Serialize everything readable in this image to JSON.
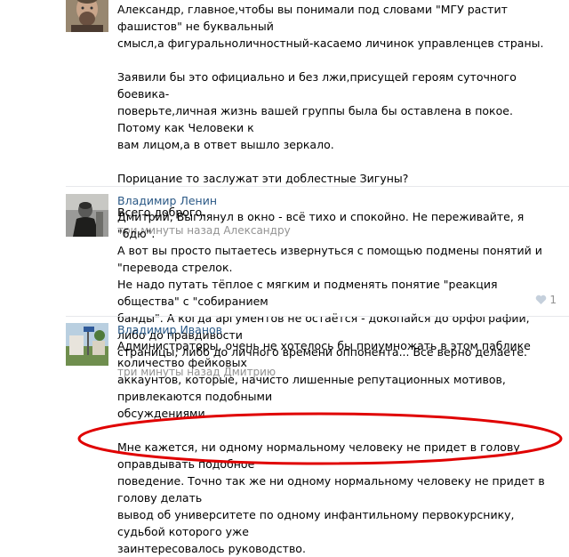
{
  "comments": [
    {
      "author": "",
      "paragraphs": [
        [
          "Александр, главное,чтобы вы понимали под словами \"МГУ растит фашистов\" не буквальный",
          "смысл,а фигуральноличностный-касаемо личинок управленцев страны."
        ],
        [
          "Заявили бы это официально и без лжи,присущей героям суточного боевика-",
          "поверьте,личная жизнь вашей группы была бы оставлена в покое. Потому как Человеки к",
          "вам лицом,а в ответ вышло зеркало."
        ],
        [
          "Порицание то заслужат эти доблестные Зигуны?"
        ],
        [
          "Всего доброго."
        ]
      ],
      "meta": "три минуты назад Александру"
    },
    {
      "author": "Владимир Ленин",
      "paragraphs": [
        [
          "Дмитрий, Выглянул в окно - всё тихо и спокойно. Не переживайте, я \"бдю\".",
          "А вот вы просто пытаетесь извернуться с помощью подмены понятий и \"перевода стрелок.",
          "Не надо путать тёплое с мягким и подменять понятие \"реакция общества\" с \"собиранием",
          "банды\". А когда аргументов не остаётся - докопайся до орфографии, либо до правдивости",
          "страницы, либо до личного времени оппонента... Всё верно делаете."
        ]
      ],
      "meta": "три минуты назад Дмитрию",
      "like_count": "1"
    },
    {
      "author": "Владимир Иванов",
      "paragraphs": [
        [
          "Администраторы, очень не хотелось бы приумножать в этом паблике количество фейковых",
          "аккаунтов, которые, начисто лишенные репутационных мотивов, привлекаются подобными",
          "обсуждениями."
        ],
        [
          "Мне кажется, ни одному нормальному человеку не придет в голову оправдывать подобное",
          "поведение. Точно так же ни одному нормальному человеку не придет в голову делать",
          "вывод об университете по одному инфантильному первокурснику, судьбой которого уже",
          "заинтересовалось руководство."
        ]
      ]
    }
  ],
  "colors": {
    "author": "#2a5885",
    "meta": "#939393",
    "separator": "#e7e8ec",
    "annotation_oval": "#e00000"
  },
  "icons": {
    "like": "heart-icon"
  }
}
